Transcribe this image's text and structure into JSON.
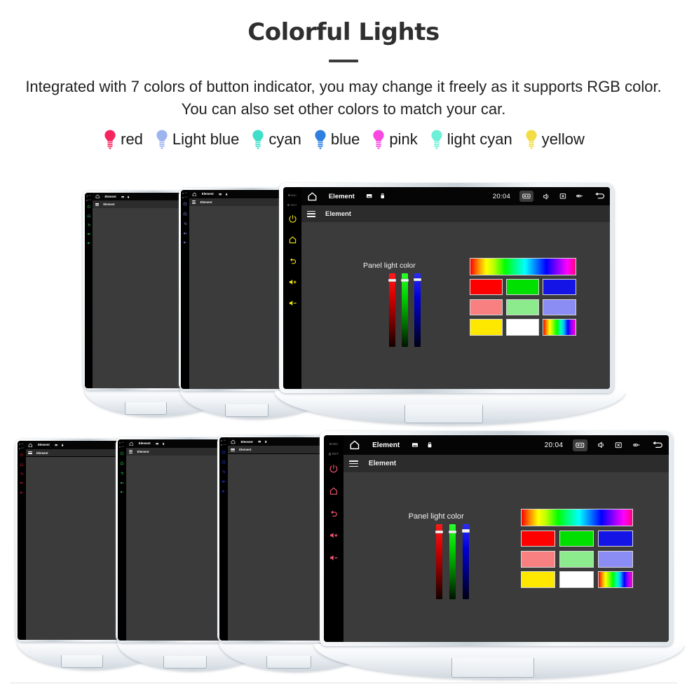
{
  "header": {
    "title": "Colorful Lights",
    "subtitle": "Integrated with 7 colors of button indicator, you may change it freely as it supports RGB color. You can also set other colors to match your car.",
    "divider_icon": "horizontal-rule-icon"
  },
  "legend": {
    "items": [
      {
        "label": "red",
        "color": "#f7255e",
        "icon": "bulb-icon"
      },
      {
        "label": "Light blue",
        "color": "#9db4f0",
        "icon": "bulb-icon"
      },
      {
        "label": "cyan",
        "color": "#3fdec9",
        "icon": "bulb-icon"
      },
      {
        "label": "blue",
        "color": "#2f7fe0",
        "icon": "bulb-icon"
      },
      {
        "label": "pink",
        "color": "#f749e0",
        "icon": "bulb-icon"
      },
      {
        "label": "light cyan",
        "color": "#6ef0d8",
        "icon": "bulb-icon"
      },
      {
        "label": "yellow",
        "color": "#f2dd45",
        "icon": "bulb-icon"
      }
    ]
  },
  "unit_ui": {
    "statusbar": {
      "home_icon": "home-icon",
      "title": "Element",
      "image_icon": "image-icon",
      "lock_icon": "lock-icon",
      "clock": "20:04",
      "screenshot_icon": "screen-capture-icon",
      "mute_icon": "speaker-mute-icon",
      "close_window_icon": "close-box-icon",
      "usb_icon": "usb-cable-icon",
      "back_icon": "back-arrow-icon"
    },
    "appbar": {
      "menu_icon": "hamburger-menu-icon",
      "title": "Element"
    },
    "panel": {
      "label": "Panel light color",
      "sliders": [
        {
          "name": "red-channel-slider",
          "color": "#ff1a1a",
          "value_pct": 92
        },
        {
          "name": "green-channel-slider",
          "color": "#2bff2b",
          "value_pct": 92
        },
        {
          "name": "blue-channel-slider",
          "color": "#2b2bff",
          "value_pct": 93
        }
      ],
      "swatches": {
        "spectrum_bar": "rainbow-gradient",
        "rows": [
          [
            {
              "name": "swatch-red",
              "color": "#ff0000"
            },
            {
              "name": "swatch-green",
              "color": "#00e000"
            },
            {
              "name": "swatch-blue",
              "color": "#1414e6"
            }
          ],
          [
            {
              "name": "swatch-salmon",
              "color": "#f98080"
            },
            {
              "name": "swatch-mint",
              "color": "#8ceb8c"
            },
            {
              "name": "swatch-periwinkle",
              "color": "#8c8cf5"
            }
          ],
          [
            {
              "name": "swatch-yellow",
              "color": "#ffe800"
            },
            {
              "name": "swatch-white",
              "color": "#ffffff"
            },
            {
              "name": "swatch-rainbow",
              "color": "rainbow"
            }
          ]
        ]
      }
    },
    "side_buttons": {
      "mic_label": "MIC",
      "rst_label": "RST",
      "buttons": [
        {
          "name": "power-button",
          "icon": "power-icon"
        },
        {
          "name": "home-button",
          "icon": "home-outline-icon"
        },
        {
          "name": "back-button",
          "icon": "back-curve-icon"
        },
        {
          "name": "volume-up-button",
          "icon": "volume-up-icon"
        },
        {
          "name": "volume-down-button",
          "icon": "volume-down-icon"
        }
      ]
    }
  },
  "rows": [
    {
      "name": "top-row",
      "units": [
        {
          "name": "unit-green",
          "led_color": "#3ddc6b",
          "size": "small",
          "show_panel": false
        },
        {
          "name": "unit-lightblue",
          "led_color": "#8f8ff0",
          "size": "small",
          "show_panel": false
        },
        {
          "name": "unit-yellow",
          "led_color": "#f5e618",
          "size": "large",
          "show_panel": true
        }
      ]
    },
    {
      "name": "bottom-row",
      "units": [
        {
          "name": "unit-red",
          "led_color": "#ee1b2e",
          "size": "small",
          "show_panel": false
        },
        {
          "name": "unit-green2",
          "led_color": "#25d94a",
          "size": "small",
          "show_panel": false
        },
        {
          "name": "unit-blue",
          "led_color": "#1f3ff0",
          "size": "small",
          "show_panel": false
        },
        {
          "name": "unit-pink",
          "led_color": "#f2566e",
          "size": "large",
          "show_panel": true
        }
      ]
    }
  ]
}
